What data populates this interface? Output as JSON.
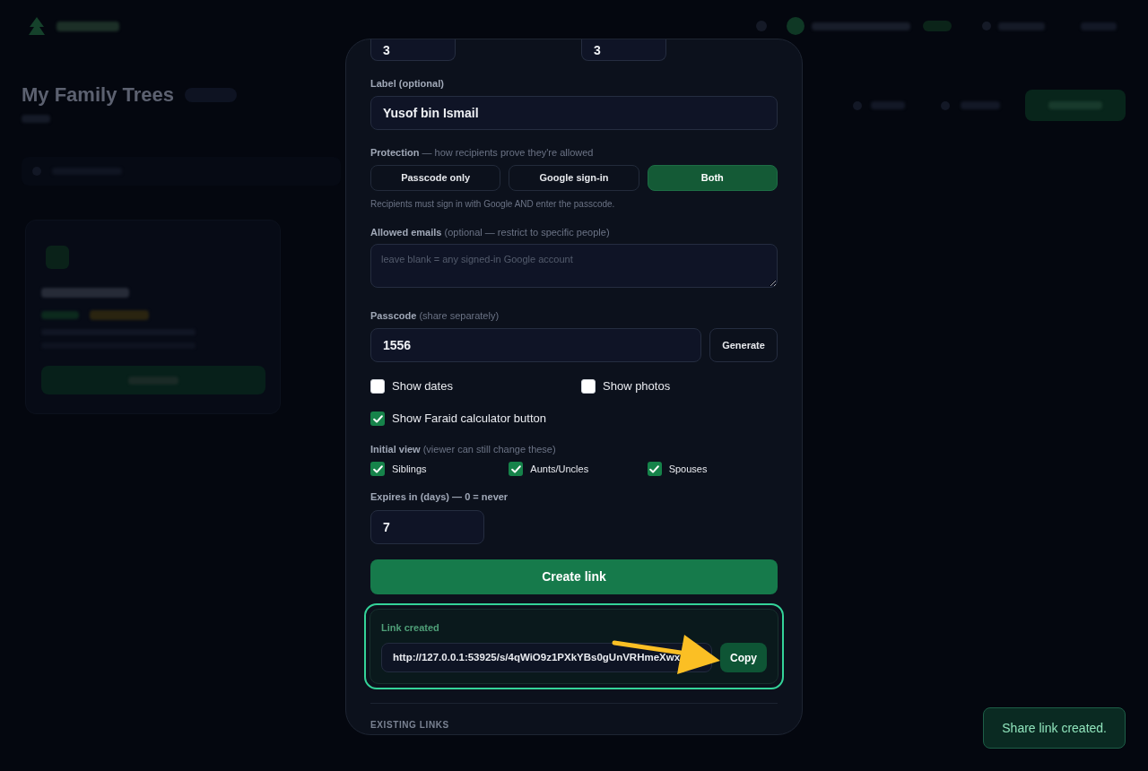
{
  "backdrop": {
    "title": "My Family Trees"
  },
  "dialog": {
    "top_fields": [
      {
        "value": "3"
      },
      {
        "value": "3"
      }
    ],
    "label_field": {
      "label": "Label (optional)",
      "value": "Yusof bin Ismail"
    },
    "protection": {
      "label": "**Protection** — how recipients prove they're allowed",
      "options": [
        {
          "label": "Passcode only",
          "selected": false
        },
        {
          "label": "Google sign-in",
          "selected": false
        },
        {
          "label": "Both",
          "selected": true
        }
      ],
      "note": "Recipients must sign in with Google AND enter the passcode."
    },
    "allowed_emails": {
      "label": "**Allowed emails** (optional — restrict to specific people)",
      "placeholder": "leave blank = any signed-in Google account"
    },
    "passcode": {
      "label": "**Passcode** (share separately)",
      "value": "1556",
      "button": "Generate"
    },
    "options": [
      {
        "label": "Show dates",
        "checked": false
      },
      {
        "label": "Show photos",
        "checked": false
      },
      {
        "label": "Show Faraid calculator button",
        "checked": true
      }
    ],
    "initial_view": {
      "label": "**Initial view** (viewer can still change these)",
      "items": [
        {
          "label": "Siblings",
          "checked": true
        },
        {
          "label": "Aunts/Uncles",
          "checked": true
        },
        {
          "label": "Spouses",
          "checked": true
        }
      ]
    },
    "expires": {
      "label": "Expires in (days) — 0 = never",
      "value": "7"
    },
    "create_button": "Create link",
    "link_result": {
      "label": "Link created",
      "value": "http://127.0.0.1:53925/s/4qWiO9z1PXkYBs0gUnVRHmeXwx",
      "button": "Copy"
    },
    "existing_links_heading": "EXISTING LINKS"
  },
  "toast": "Share link created."
}
